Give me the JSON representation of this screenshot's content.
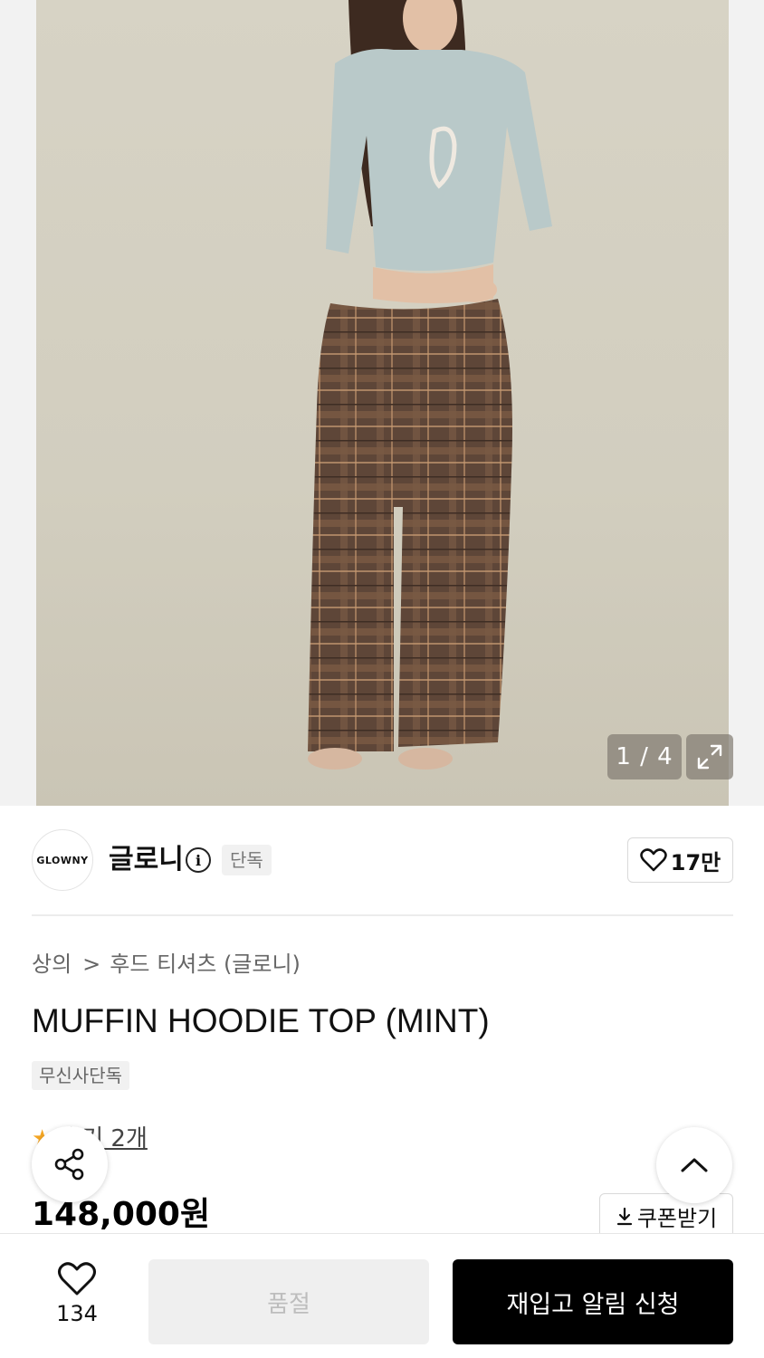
{
  "hero": {
    "counter": "1 / 4"
  },
  "brand": {
    "logo_text": "GLOWNY",
    "name": "글로니",
    "info_glyph": "i",
    "badge": "단독",
    "like_count": "17만"
  },
  "product": {
    "breadcrumb": [
      "상의",
      "후드 티셔츠 (글로니)"
    ],
    "breadcrumb_sep": ">",
    "title": "MUFFIN HOODIE TOP (MINT)",
    "tag": "무신사단독",
    "review_star": "★",
    "review_text": "후기 2개",
    "price": "148,000원",
    "coupon_label": "쿠폰받기"
  },
  "bottom_bar": {
    "wish_count": "134",
    "soldout_label": "품절",
    "restock_label": "재입고 알림 신청"
  },
  "icons": {
    "expand": "expand-icon",
    "info": "info-icon",
    "heart": "heart-icon",
    "share": "share-icon",
    "chevron_up": "chevron-up-icon",
    "download": "download-icon",
    "star": "star-icon"
  },
  "colors": {
    "primary_button": "#000000",
    "disabled_button": "#efefef",
    "star": "#f5a623"
  }
}
